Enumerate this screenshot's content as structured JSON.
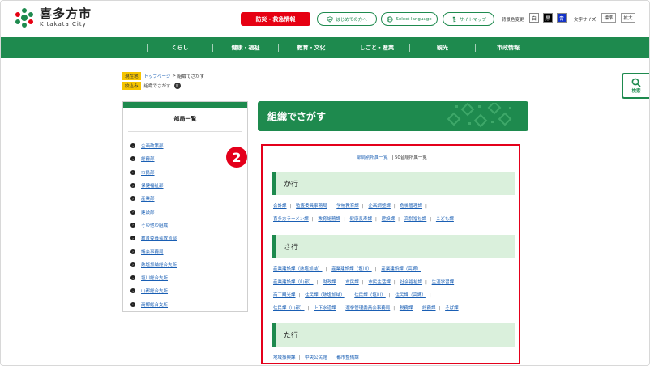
{
  "header": {
    "logo_ja": "喜多方市",
    "logo_en": "Kitakata City",
    "disaster_button": "防災・救急情報",
    "beginners": "はじめての方へ",
    "language": "Select language",
    "sitemap": "サイトマップ",
    "color_label": "背景色変更",
    "color_white": "白",
    "color_black": "黒",
    "color_blue": "青",
    "font_label": "文字サイズ",
    "font_standard": "標準",
    "font_large": "拡大"
  },
  "nav": {
    "items": [
      "くらし",
      "健康・福祉",
      "教育・文化",
      "しごと・産業",
      "観光",
      "市政情報"
    ]
  },
  "breadcrumb": {
    "current_tag": "現在地",
    "top_link": "トップページ",
    "separator": ">",
    "current": "組織でさがす",
    "filter_tag": "絞込み",
    "filter_value": "組織でさがす"
  },
  "sidebar": {
    "title": "部局一覧",
    "items": [
      "企画政策部",
      "総務部",
      "市民部",
      "保健福祉部",
      "産業部",
      "建設部",
      "その他の組織",
      "教育委員会教育部",
      "議会事務局",
      "熱塩加納総合支所",
      "塩川総合支所",
      "山都総合支所",
      "高郷総合支所"
    ]
  },
  "main": {
    "title": "組織でさがす",
    "subnav_a": "部局別所属一覧",
    "subnav_sep": "|",
    "subnav_b": "50音順所属一覧",
    "badge": "2",
    "sections": [
      {
        "heading": "か行",
        "rows": [
          [
            "会計課",
            "監査委員事務局",
            "学校教育課",
            "企画調整課",
            "危機管理課"
          ],
          [
            "喜多方ラーメン課",
            "教育総務課",
            "健康長寿課",
            "建設課",
            "高齢福祉課",
            "こども課"
          ]
        ]
      },
      {
        "heading": "さ行",
        "rows": [
          [
            "産業建設課（熱塩加納）",
            "産業建設課（塩川）",
            "産業建設課（高郷）"
          ],
          [
            "産業建設課（山都）",
            "財政課",
            "市民課",
            "市民生活課",
            "社会福祉課",
            "生涯学習課"
          ],
          [
            "商工観光課",
            "住民課（熱塩加納）",
            "住民課（塩川）",
            "住民課（高郷）"
          ],
          [
            "住民課（山都）",
            "上下水道課",
            "選挙管理委員会事務局",
            "税務課",
            "総務課",
            "そば課"
          ]
        ]
      },
      {
        "heading": "た行",
        "rows": [
          [
            "地域振興課",
            "中央公民館",
            "都市整備課"
          ]
        ]
      }
    ]
  },
  "side_search": {
    "label": "検索"
  },
  "colors": {
    "brand_green": "#1e8a4e",
    "alert_red": "#e60012",
    "tag_yellow": "#f5c400",
    "section_bg": "#daf0dc",
    "link_blue": "#1a5fb4"
  },
  "icons": [
    "logo-mark-icon",
    "shield-icon",
    "globe-icon",
    "sitemap-icon",
    "bullet-arrow-icon",
    "close-icon",
    "search-icon"
  ]
}
